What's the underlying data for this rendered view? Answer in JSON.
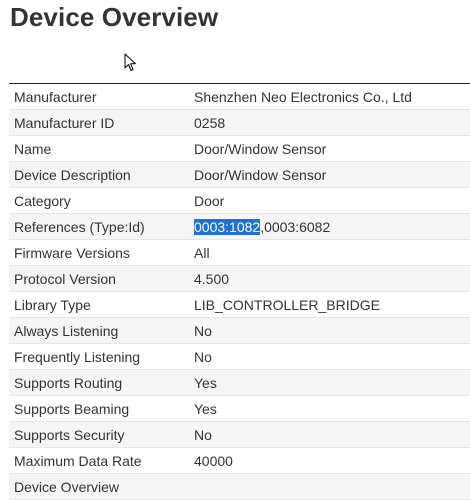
{
  "page": {
    "title": "Device Overview"
  },
  "details": {
    "rows": [
      {
        "label": "Manufacturer",
        "value": "Shenzhen Neo Electronics Co., Ltd"
      },
      {
        "label": "Manufacturer ID",
        "value": "0258"
      },
      {
        "label": "Name",
        "value": "Door/Window Sensor"
      },
      {
        "label": "Device Description",
        "value": "Door/Window Sensor"
      },
      {
        "label": "Category",
        "value": "Door"
      },
      {
        "label": "References (Type:Id)",
        "value_selected": "0003:1082",
        "value_rest": ",0003:6082"
      },
      {
        "label": "Firmware Versions",
        "value": "All"
      },
      {
        "label": "Protocol Version",
        "value": "4.500"
      },
      {
        "label": "Library Type",
        "value": "LIB_CONTROLLER_BRIDGE"
      },
      {
        "label": "Always Listening",
        "value": "No"
      },
      {
        "label": "Frequently Listening",
        "value": "No"
      },
      {
        "label": "Supports Routing",
        "value": "Yes"
      },
      {
        "label": "Supports Beaming",
        "value": "Yes"
      },
      {
        "label": "Supports Security",
        "value": "No"
      },
      {
        "label": "Maximum Data Rate",
        "value": "40000"
      },
      {
        "label": "Device Overview",
        "value": ""
      }
    ]
  },
  "colors": {
    "selection": "#1f6fd6",
    "row_alt": "#f5f5f5",
    "text": "#333333"
  },
  "icons": {
    "cursor": "arrow-cursor-icon"
  }
}
